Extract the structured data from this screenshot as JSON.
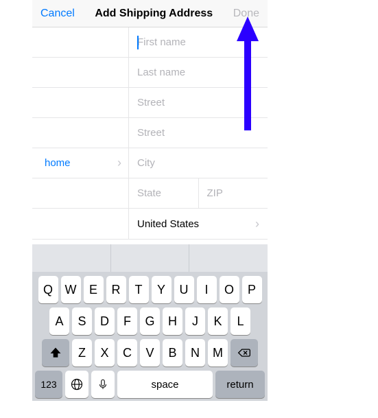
{
  "navbar": {
    "cancel": "Cancel",
    "title": "Add Shipping Address",
    "done": "Done"
  },
  "form": {
    "label": "home",
    "first_name_placeholder": "First name",
    "last_name_placeholder": "Last name",
    "street1_placeholder": "Street",
    "street2_placeholder": "Street",
    "city_placeholder": "City",
    "state_placeholder": "State",
    "zip_placeholder": "ZIP",
    "country": "United States"
  },
  "keyboard": {
    "row1": [
      "Q",
      "W",
      "E",
      "R",
      "T",
      "Y",
      "U",
      "I",
      "O",
      "P"
    ],
    "row2": [
      "A",
      "S",
      "D",
      "F",
      "G",
      "H",
      "J",
      "K",
      "L"
    ],
    "row3": [
      "Z",
      "X",
      "C",
      "V",
      "B",
      "N",
      "M"
    ],
    "numbers": "123",
    "space": "space",
    "return": "return"
  },
  "annotation": {
    "arrow_color": "#2b00ff"
  }
}
